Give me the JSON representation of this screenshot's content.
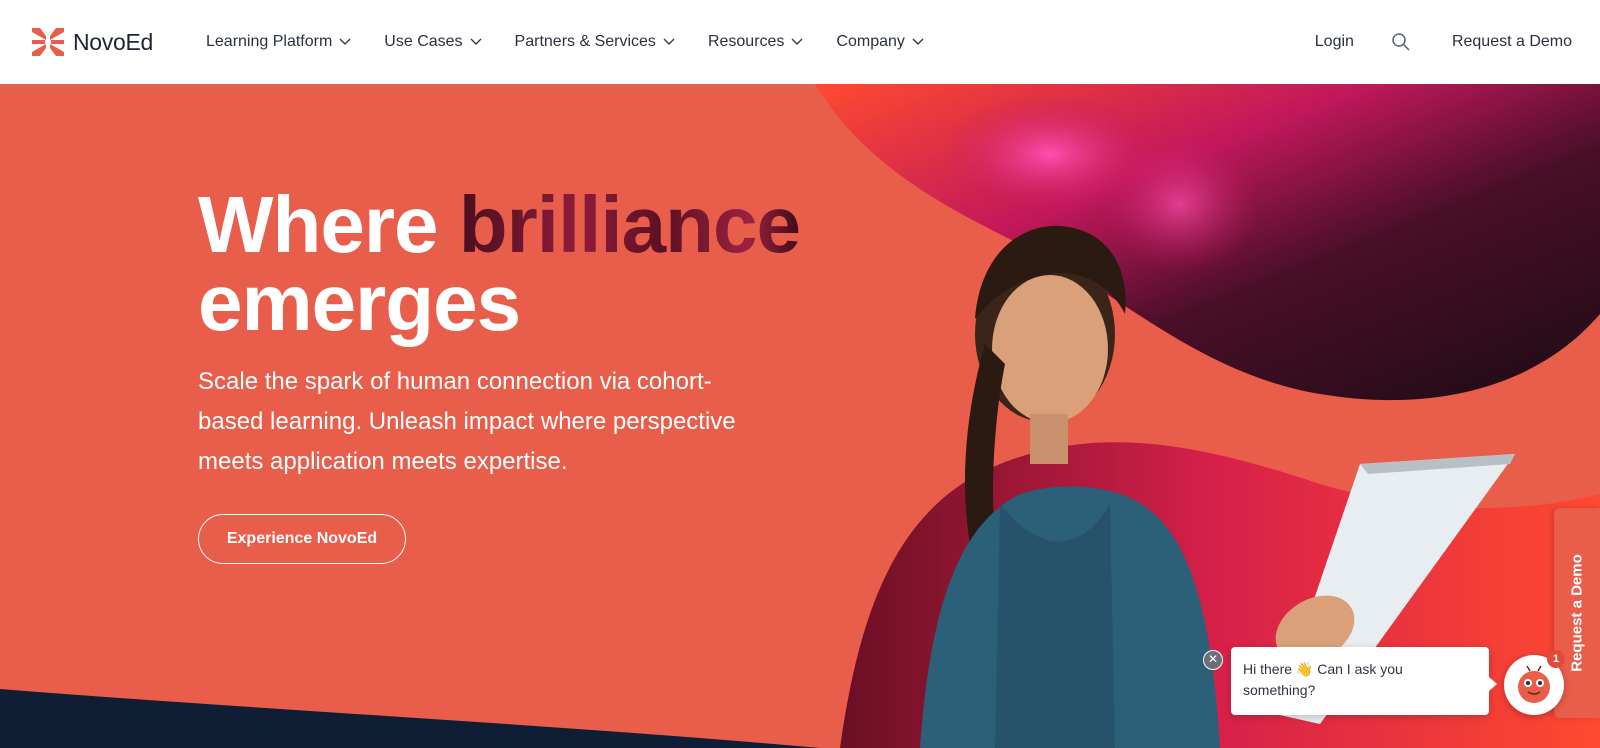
{
  "brand": {
    "name": "NovoEd",
    "accent": "#e95e4a"
  },
  "nav": {
    "items": [
      {
        "label": "Learning Platform",
        "icon": "chevron-down-icon"
      },
      {
        "label": "Use Cases",
        "icon": "chevron-down-icon"
      },
      {
        "label": "Partners & Services",
        "icon": "chevron-down-icon"
      },
      {
        "label": "Resources",
        "icon": "chevron-down-icon"
      },
      {
        "label": "Company",
        "icon": "chevron-down-icon"
      }
    ],
    "login": "Login",
    "search_icon": "search-icon",
    "request_demo": "Request a Demo"
  },
  "hero": {
    "headline_prefix": "Where ",
    "headline_accent": "brilliance",
    "headline_suffix": "emerges",
    "subhead": "Scale the spark of human connection via cohort-based learning. Unleash impact where perspective meets application meets expertise.",
    "cta": "Experience NovoEd"
  },
  "side_tab": {
    "label": "Request a Demo"
  },
  "chat": {
    "message": "Hi there 👋 Can I ask you something?",
    "badge_count": "1",
    "close_icon": "close-icon",
    "avatar_icon": "chatbot-avatar-icon"
  }
}
